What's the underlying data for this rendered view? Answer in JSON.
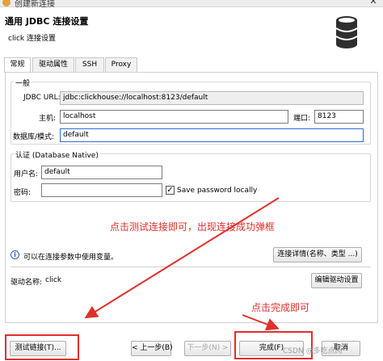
{
  "window": {
    "title": "创建新连接"
  },
  "header": {
    "title": "通用 JDBC 连接设置",
    "subtitle": "click 连接设置",
    "icon": "database-icon"
  },
  "tabs": [
    {
      "label": "常规",
      "active": true
    },
    {
      "label": "驱动属性",
      "active": false
    },
    {
      "label": "SSH",
      "active": false
    },
    {
      "label": "Proxy",
      "active": false
    }
  ],
  "general": {
    "legend": "一般",
    "jdbc_url_label": "JDBC URL:",
    "jdbc_url_value": "jdbc:clickhouse://localhost:8123/default",
    "host_label": "主机:",
    "host_value": "localhost",
    "port_label": "端口:",
    "port_value": "8123",
    "database_label": "数据库/模式:",
    "database_value": "default"
  },
  "auth": {
    "legend": "认证 (Database Native)",
    "username_label": "用户名:",
    "username_value": "default",
    "password_label": "密码:",
    "password_value": "",
    "save_password_label": "Save password locally",
    "save_password_checked": true
  },
  "info": {
    "text": "可以在连接参数中使用变量。",
    "details_button": "连接详情(名称、类型 ...)"
  },
  "driver": {
    "label": "驱动名称:",
    "value": "click",
    "edit_button": "编辑驱动设置"
  },
  "footer": {
    "test_button": "测试链接(T)...",
    "back_button": "< 上一步(B)",
    "next_button": "下一步(N) >",
    "finish_button": "完成(F)",
    "cancel_button": "取消"
  },
  "annotations": {
    "test_note": "点击测试连接即可，出现连接成功弹框",
    "finish_note": "点击完成即可",
    "color": "#e0302a"
  },
  "watermark": "CSDN @多吃点肉"
}
